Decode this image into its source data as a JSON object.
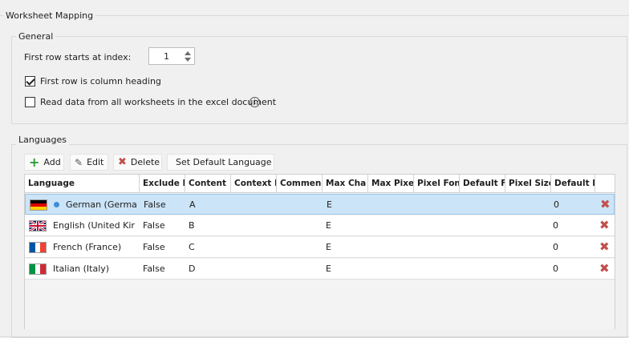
{
  "group_main": {
    "title": "Worksheet Mapping"
  },
  "general": {
    "title": "General",
    "first_row_label": "First row starts at index:",
    "first_row_value": "1",
    "heading_checkbox_label": "First row is column heading",
    "heading_checked": true,
    "all_sheets_label": "Read data from all worksheets in the excel document",
    "all_sheets_checked": false,
    "info_glyph": "i"
  },
  "languages": {
    "title": "Languages",
    "toolbar": {
      "add": "Add",
      "edit": "Edit",
      "delete": "Delete",
      "set_default": "Set Default Language"
    },
    "columns": [
      "Language",
      "Exclude I",
      "Content",
      "Context I",
      "Commen",
      "Max Cha",
      "Max Pixe",
      "Pixel Fon",
      "Default F",
      "Pixel Size",
      "Default F"
    ],
    "rows": [
      {
        "flag": "de-flag",
        "default": true,
        "language": "German (Germa",
        "exclude": "False",
        "content": "A",
        "max_chars": "E",
        "pixel_size": "0",
        "delete": "✖"
      },
      {
        "flag": "gb-flag",
        "default": false,
        "language": "English (United Kir",
        "exclude": "False",
        "content": "B",
        "max_chars": "E",
        "pixel_size": "0",
        "delete": "✖"
      },
      {
        "flag": "fr-flag",
        "default": false,
        "language": "French (France)",
        "exclude": "False",
        "content": "C",
        "max_chars": "E",
        "pixel_size": "0",
        "delete": "✖"
      },
      {
        "flag": "it-flag",
        "default": false,
        "language": "Italian (Italy)",
        "exclude": "False",
        "content": "D",
        "max_chars": "E",
        "pixel_size": "0",
        "delete": "✖"
      }
    ]
  },
  "colors": {
    "selection": "#cce4f7",
    "delete_red": "#c0504d",
    "add_green": "#2e9c36",
    "default_dot": "#3d8fd6"
  }
}
